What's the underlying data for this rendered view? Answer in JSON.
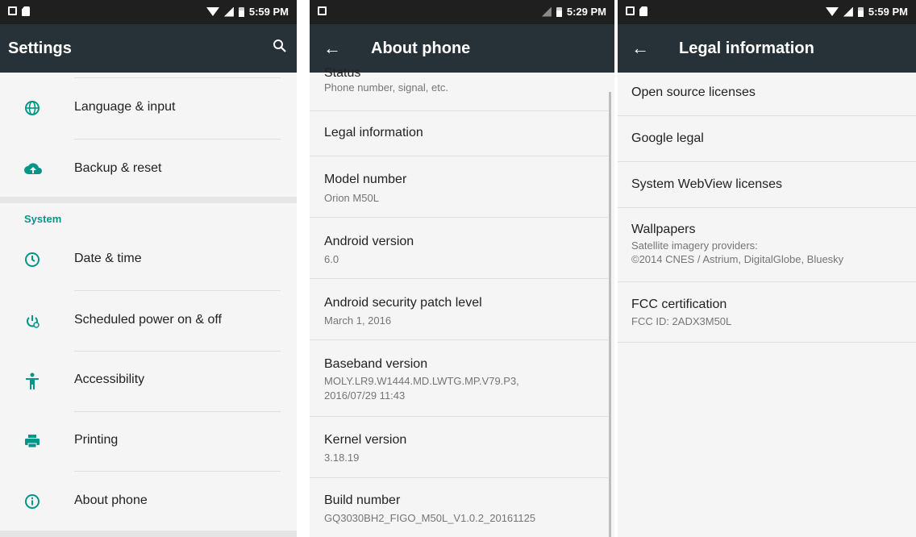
{
  "colors": {
    "appbar": "#263238",
    "statusbar": "#1f1f1f",
    "accent": "#009688",
    "icon": "#009688"
  },
  "screen1": {
    "status_time": "5:59 PM",
    "title": "Settings",
    "search_icon": "search-icon",
    "items_top": [
      {
        "label": "Language & input",
        "icon": "globe-icon"
      },
      {
        "label": "Backup & reset",
        "icon": "cloud-upload-icon"
      }
    ],
    "section_header": "System",
    "items_system": [
      {
        "label": "Date & time",
        "icon": "clock-icon"
      },
      {
        "label": "Scheduled power on & off",
        "icon": "power-schedule-icon"
      },
      {
        "label": "Accessibility",
        "icon": "accessibility-icon"
      },
      {
        "label": "Printing",
        "icon": "printer-icon"
      },
      {
        "label": "About phone",
        "icon": "info-icon"
      }
    ]
  },
  "screen2": {
    "status_time": "5:29 PM",
    "title": "About phone",
    "items": [
      {
        "title": "Status",
        "subtitle": "Phone number, signal, etc."
      },
      {
        "title": "Legal information",
        "subtitle": ""
      },
      {
        "title": "Model number",
        "subtitle": "Orion M50L"
      },
      {
        "title": "Android version",
        "subtitle": "6.0"
      },
      {
        "title": "Android security patch level",
        "subtitle": "March 1, 2016"
      },
      {
        "title": "Baseband version",
        "subtitle": "MOLY.LR9.W1444.MD.LWTG.MP.V79.P3,",
        "subtitle2": "2016/07/29 11:43"
      },
      {
        "title": "Kernel version",
        "subtitle": "3.18.19"
      },
      {
        "title": "Build number",
        "subtitle": "GQ3030BH2_FIGO_M50L_V1.0.2_20161125"
      }
    ]
  },
  "screen3": {
    "status_time": "5:59 PM",
    "title": "Legal information",
    "items": [
      {
        "title": "Open source licenses"
      },
      {
        "title": "Google legal"
      },
      {
        "title": "System WebView licenses"
      },
      {
        "title": "Wallpapers",
        "subtitle": "Satellite imagery providers:",
        "subtitle2": "©2014 CNES / Astrium, DigitalGlobe, Bluesky"
      },
      {
        "title": "FCC certification",
        "subtitle": "FCC ID: 2ADX3M50L"
      }
    ]
  }
}
